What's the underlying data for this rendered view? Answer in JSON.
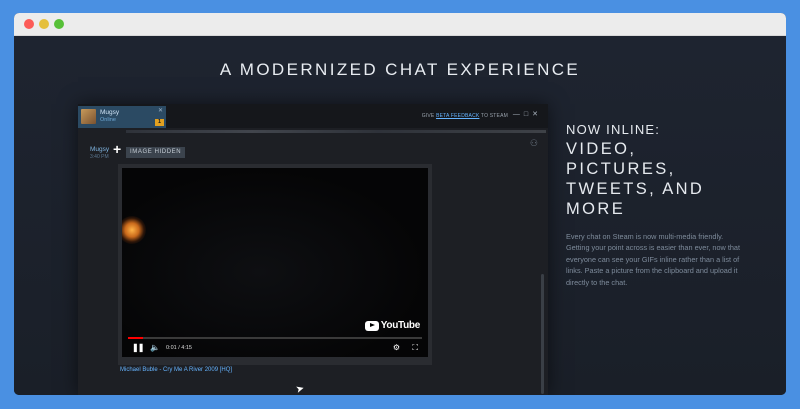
{
  "hero": {
    "title": "A MODERNIZED CHAT EXPERIENCE"
  },
  "chat_window": {
    "tab": {
      "name": "Mugsy",
      "status": "Online",
      "close": "✕",
      "badge": "1"
    },
    "feedback": {
      "prefix": "GIVE",
      "link": "BETA FEEDBACK",
      "suffix": "TO STEAM"
    },
    "window_controls": "—□✕",
    "message": {
      "sender": "Mugsy",
      "time": "3:40 PM",
      "add_symbol": "+",
      "image_hidden_label": "IMAGE HIDDEN"
    },
    "video": {
      "brand": "YouTube",
      "time": "0:01 / 4:15",
      "progress_fraction": 0.05,
      "caption": "Michael Buble - Cry Me A River 2009 [HQ]"
    }
  },
  "feature": {
    "kicker": "NOW INLINE:",
    "lines": [
      "VIDEO,",
      "PICTURES,",
      "TWEETS, AND",
      "MORE"
    ],
    "description": "Every chat on Steam is now multi-media friendly. Getting your point across is easier than ever, now that everyone can see your GIFs inline rather than a list of links. Paste a picture from the clipboard and upload it directly to the chat."
  },
  "colors": {
    "accent": "#66b4ff",
    "background": "#1b2029",
    "outer": "#4a90e2",
    "badge": "#e1a020",
    "progress": "#ff0000"
  },
  "icons": [
    "pause-icon",
    "volume-icon",
    "settings-gear-icon",
    "fullscreen-icon",
    "add-friend-icon",
    "youtube-play-icon",
    "mouse-cursor-icon"
  ]
}
